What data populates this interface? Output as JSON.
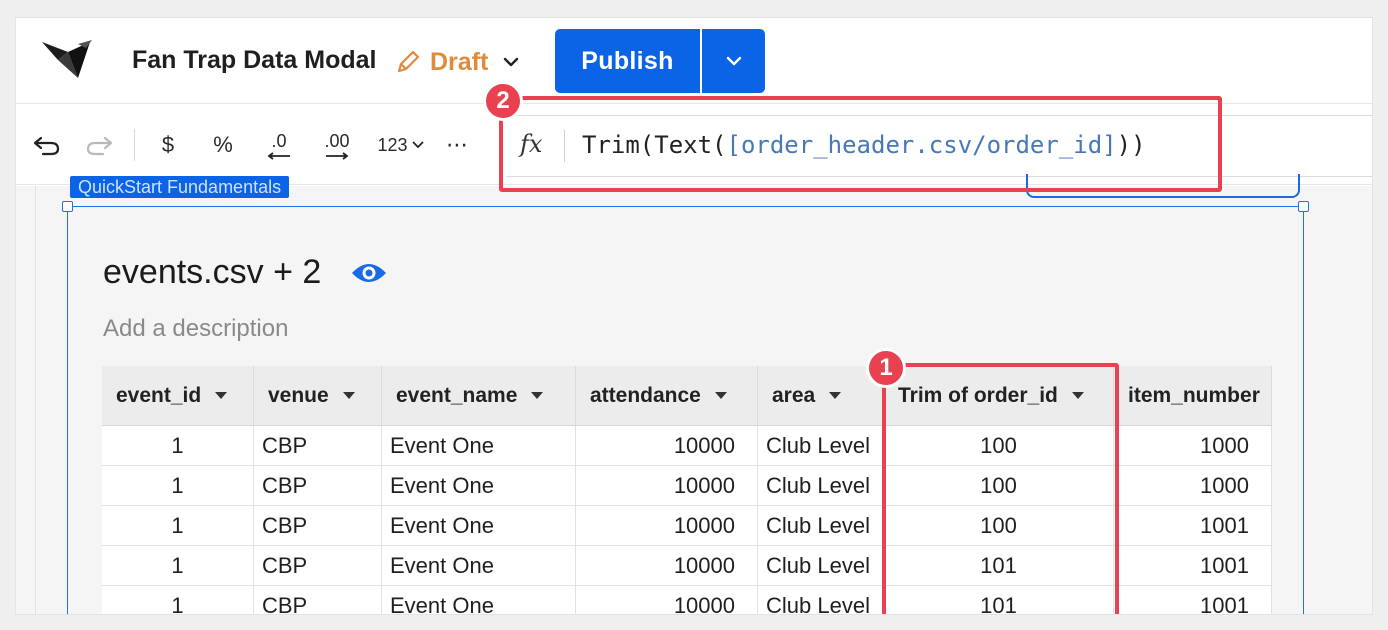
{
  "app": {
    "title": "Fan Trap Data Modal",
    "status": "Draft",
    "publish_label": "Publish"
  },
  "toolbar": {
    "undo_icon": "undo-icon",
    "redo_icon": "redo-icon",
    "currency_label": "$",
    "percent_label": "%",
    "decrease_decimals_label": ".0",
    "increase_decimals_label": ".00",
    "number_format_label": "123",
    "more_label": "⋯"
  },
  "formula_bar": {
    "fx_label": "fx",
    "prefix": "Trim(Text(",
    "reference": "[order_header.csv/order_id]",
    "suffix": "))"
  },
  "canvas": {
    "page_tag": "QuickStart Fundamentals"
  },
  "element": {
    "title": "events.csv + 2",
    "description_placeholder": "Add a description"
  },
  "table": {
    "columns": [
      "event_id",
      "venue",
      "event_name",
      "attendance",
      "area",
      "Trim of order_id",
      "item_number"
    ],
    "rows": [
      [
        "1",
        "CBP",
        "Event One",
        "10000",
        "Club Level",
        "100",
        "1000"
      ],
      [
        "1",
        "CBP",
        "Event One",
        "10000",
        "Club Level",
        "100",
        "1000"
      ],
      [
        "1",
        "CBP",
        "Event One",
        "10000",
        "Club Level",
        "100",
        "1001"
      ],
      [
        "1",
        "CBP",
        "Event One",
        "10000",
        "Club Level",
        "101",
        "1001"
      ],
      [
        "1",
        "CBP",
        "Event One",
        "10000",
        "Club Level",
        "101",
        "1001"
      ]
    ]
  },
  "annotations": {
    "badge_1": "1",
    "badge_2": "2",
    "color": "#e8414f"
  },
  "colors": {
    "accent": "#0b63e5",
    "draft": "#e08a3c",
    "formula_reference": "#4778b8"
  }
}
